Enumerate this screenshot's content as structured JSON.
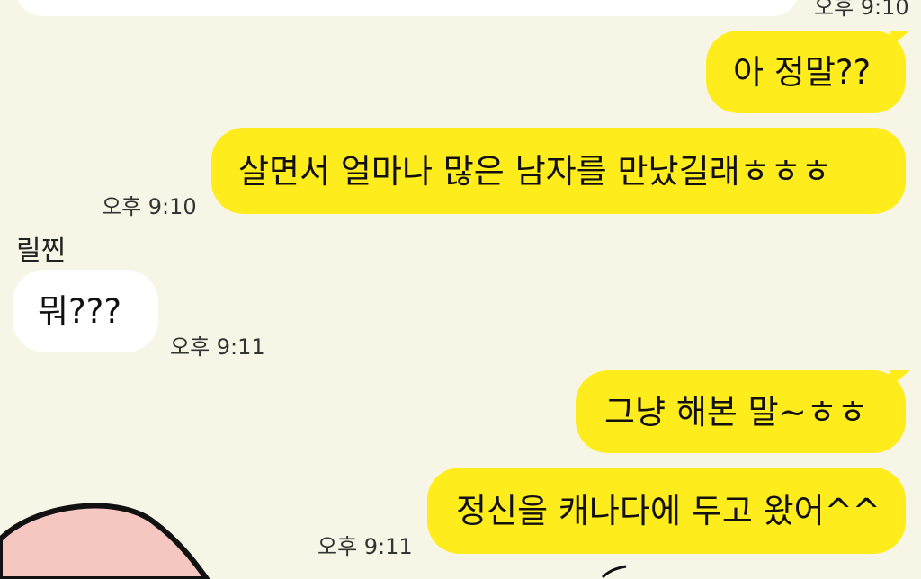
{
  "timestamps": {
    "top": "오후 9:10",
    "t1": "오후 9:10",
    "t2": "오후 9:11",
    "t3": "오후 9:11"
  },
  "messages": [
    {
      "sender": "me",
      "text": "아 정말??"
    },
    {
      "sender": "me",
      "text": "살면서 얼마나 많은 남자를 만났길래ㅎㅎㅎ"
    },
    {
      "sender": "릴찐",
      "text": "뭐???"
    },
    {
      "sender": "me",
      "text": "그냥 해본 말~ㅎㅎ"
    },
    {
      "sender": "me",
      "text": "정신을 캐나다에 두고 왔어^^"
    }
  ],
  "contact_name": "릴찐",
  "colors": {
    "background": "#f7f6e6",
    "outgoing_bubble": "#ffec1c",
    "incoming_bubble": "#ffffff",
    "sticker_fill": "#f6c7c0"
  },
  "sticker": {
    "icon": "pink-character-sticker-icon"
  }
}
